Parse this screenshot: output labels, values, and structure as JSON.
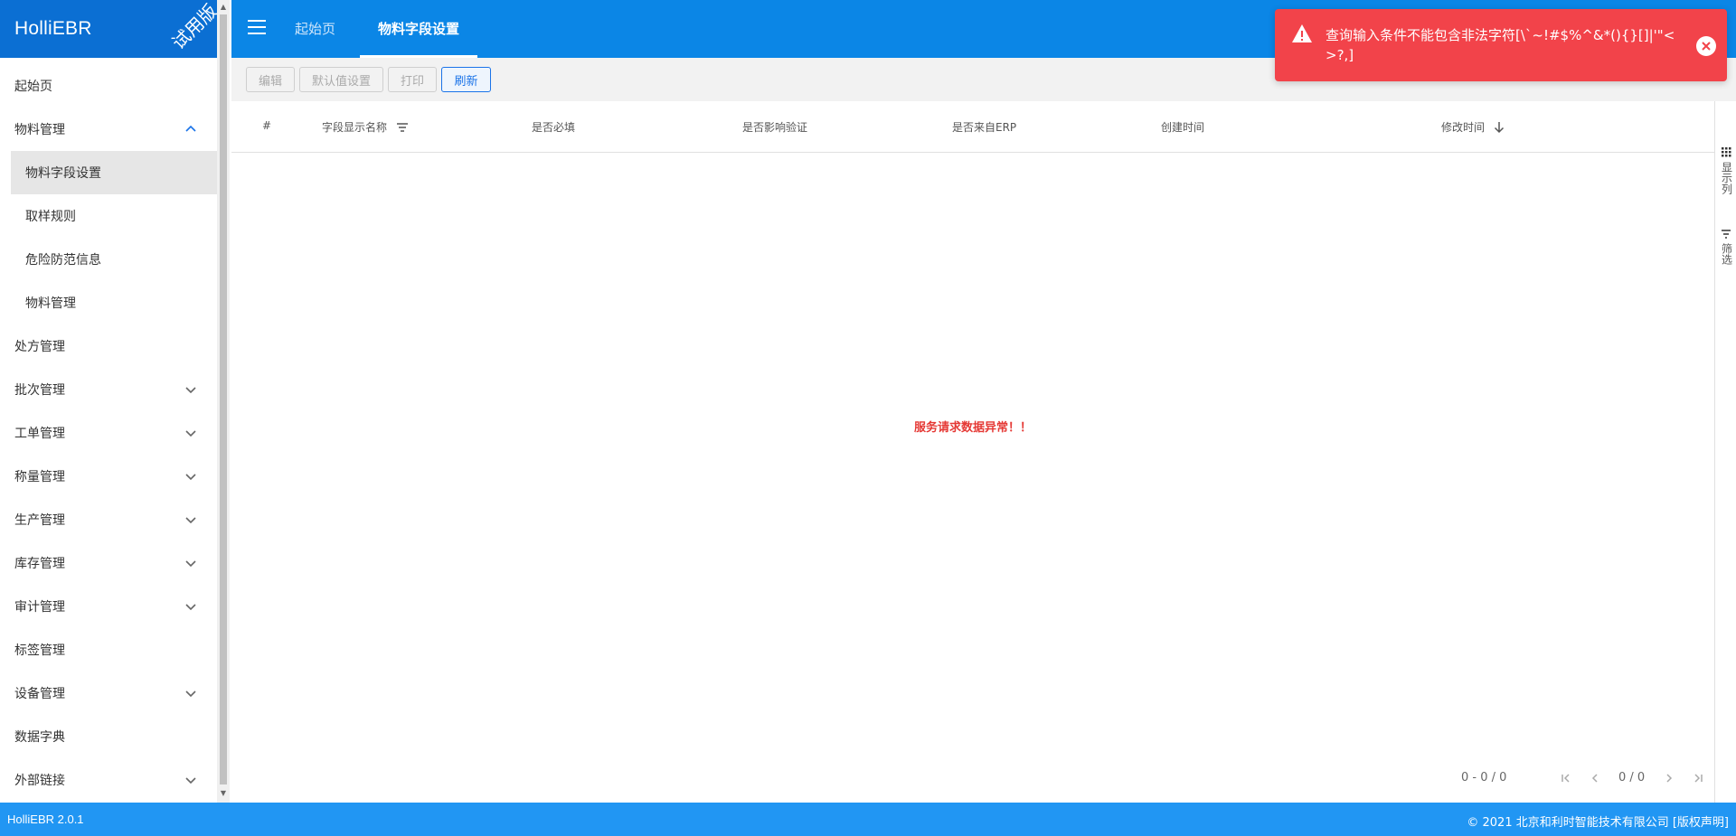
{
  "app": {
    "name": "HolliEBR",
    "trial_label": "试用版"
  },
  "sidebar": {
    "items": [
      {
        "label": "起始页"
      },
      {
        "label": "物料管理"
      },
      {
        "label": "物料字段设置"
      },
      {
        "label": "取样规则"
      },
      {
        "label": "危险防范信息"
      },
      {
        "label": "物料管理"
      },
      {
        "label": "处方管理"
      },
      {
        "label": "批次管理"
      },
      {
        "label": "工单管理"
      },
      {
        "label": "称量管理"
      },
      {
        "label": "生产管理"
      },
      {
        "label": "库存管理"
      },
      {
        "label": "审计管理"
      },
      {
        "label": "标签管理"
      },
      {
        "label": "设备管理"
      },
      {
        "label": "数据字典"
      },
      {
        "label": "外部链接"
      }
    ]
  },
  "tabs": [
    {
      "label": "起始页"
    },
    {
      "label": "物料字段设置"
    }
  ],
  "toolbar": {
    "edit": "编辑",
    "default_settings": "默认值设置",
    "print": "打印",
    "refresh": "刷新"
  },
  "table": {
    "columns": [
      "#",
      "字段显示名称",
      "是否必填",
      "是否影响验证",
      "是否来自ERP",
      "创建时间",
      "修改时间"
    ],
    "empty_message": "服务请求数据异常！！"
  },
  "pagination": {
    "range": "0 - 0 / 0",
    "page": "0 / 0"
  },
  "side_panel": {
    "columns": "显示列",
    "filter": "筛选"
  },
  "toast": {
    "message": "查询输入条件不能包含非法字符[\\`~!#$%^&*(){}[]|'\"<>?,]"
  },
  "status": {
    "version": "HolliEBR 2.0.1",
    "copyright": "© 2021  北京和利时智能技术有限公司 [版权声明]"
  },
  "colors": {
    "brand": "#0b6fd3",
    "topbar": "#0b86e6",
    "statusbar": "#2196f3",
    "toast": "#f2434a",
    "error_text": "#e53935"
  }
}
